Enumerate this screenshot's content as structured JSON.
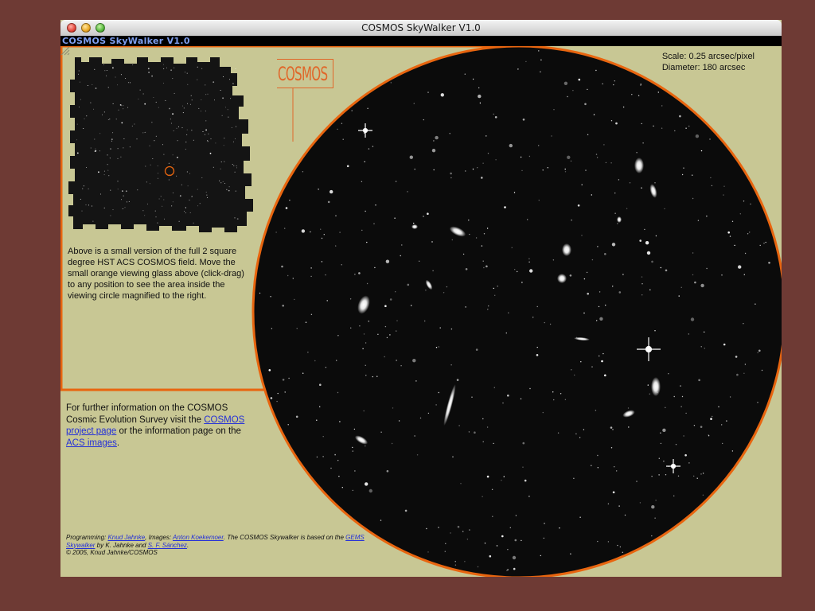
{
  "window": {
    "title": "COSMOS SkyWalker V1.0",
    "app_name": "COSMOS SkyWalker V1.0"
  },
  "scale_info": {
    "scale": "Scale: 0.25 arcsec/pixel",
    "diameter": "Diameter: 180 arcsec"
  },
  "logo": {
    "text": "COSMOS"
  },
  "description": "Above is a small version of the full 2 square degree HST ACS COSMOS field. Move the small orange viewing glass above (click-drag) to any position to see the area inside the viewing circle magnified to the right.",
  "info": {
    "text_1": "For further information on the COSMOS Cosmic Evolution Survey visit the ",
    "link_cosmos": "COSMOS project page",
    "text_2": " or the information page on the ",
    "link_acs": "ACS images",
    "text_3": "."
  },
  "credits": {
    "t1": "Programming: ",
    "l1": "Knud Jahnke",
    "t2": ", Images: ",
    "l2": "Anton Koekemoer",
    "t3": ". The COSMOS Skywalker is based on the ",
    "l3": "GEMS Skywalker",
    "t4": " by K. Jahnke and ",
    "l4": "S. F. Sánchez",
    "t5": ".",
    "copyright": "© 2005, Knud Jahnke/COSMOS"
  },
  "colors": {
    "background": "#6e3a34",
    "panel": "#c8c794",
    "accent_orange": "#e8650f",
    "link_blue": "#2430d8",
    "app_name_blue": "#7f9ff0"
  }
}
